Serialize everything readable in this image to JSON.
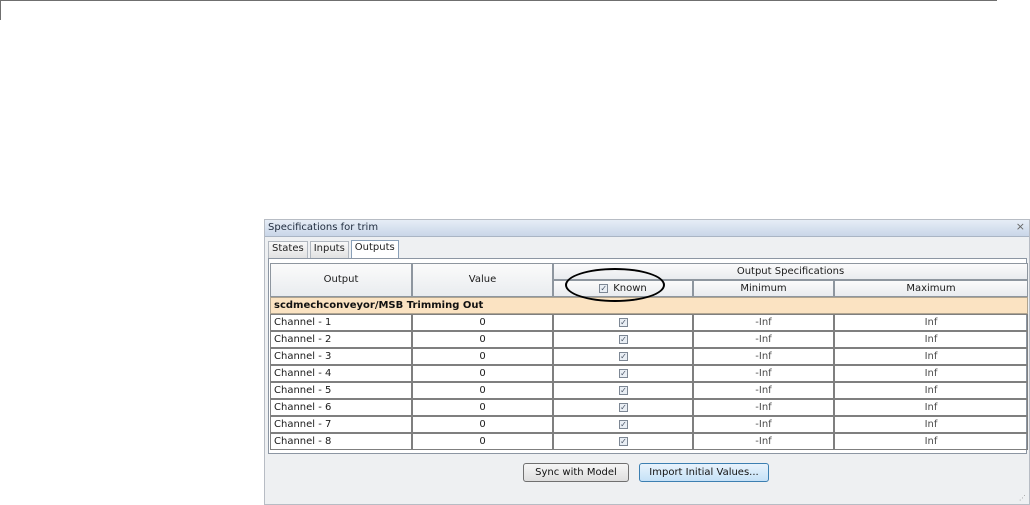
{
  "panel": {
    "title": "Specifications for trim",
    "close_glyph": "×"
  },
  "tabs": [
    {
      "label": "States"
    },
    {
      "label": "Inputs"
    },
    {
      "label": "Outputs",
      "active": true
    }
  ],
  "table": {
    "headers": {
      "output": "Output",
      "value": "Value",
      "output_specs": "Output Specifications",
      "known": "Known",
      "minimum": "Minimum",
      "maximum": "Maximum"
    },
    "group": "scdmechconveyor/MSB Trimming Out",
    "rows": [
      {
        "name": "Channel - 1",
        "value": "0",
        "known": true,
        "min": "-Inf",
        "max": "Inf"
      },
      {
        "name": "Channel - 2",
        "value": "0",
        "known": true,
        "min": "-Inf",
        "max": "Inf"
      },
      {
        "name": "Channel - 3",
        "value": "0",
        "known": true,
        "min": "-Inf",
        "max": "Inf"
      },
      {
        "name": "Channel - 4",
        "value": "0",
        "known": true,
        "min": "-Inf",
        "max": "Inf"
      },
      {
        "name": "Channel - 5",
        "value": "0",
        "known": true,
        "min": "-Inf",
        "max": "Inf"
      },
      {
        "name": "Channel - 6",
        "value": "0",
        "known": true,
        "min": "-Inf",
        "max": "Inf"
      },
      {
        "name": "Channel - 7",
        "value": "0",
        "known": true,
        "min": "-Inf",
        "max": "Inf"
      },
      {
        "name": "Channel - 8",
        "value": "0",
        "known": true,
        "min": "-Inf",
        "max": "Inf"
      }
    ]
  },
  "buttons": {
    "sync": "Sync with Model",
    "import": "Import Initial Values..."
  },
  "colors": {
    "group_row": "#fbe3c2",
    "highlight_button": "#c5e1f7"
  }
}
